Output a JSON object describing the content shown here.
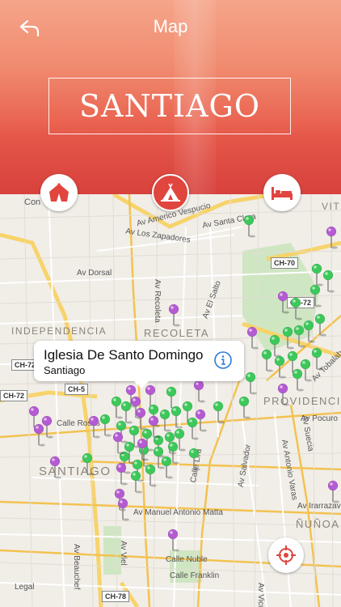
{
  "header": {
    "title": "Map",
    "city": "SANTIAGO"
  },
  "icons": {
    "back": "back-arrow-icon",
    "attractions": "circus-tent-icon",
    "activities": "camping-tent-icon",
    "lodging": "bed-icon",
    "info": "info-icon",
    "locate": "crosshair-icon"
  },
  "callout": {
    "title": "Iglesia De Santo Domingo",
    "subtitle": "Santiago"
  },
  "map_labels": {
    "streets": [
      "Av Americo Vespucio",
      "Av Santa Clara",
      "Av Los Zapadores",
      "Av Dorsal",
      "Av Recoleta",
      "Av El Salto",
      "Calle Rosas",
      "Av Manuel Antonio Matta",
      "Calle Nuble",
      "Calle Franklin",
      "Calle Lira",
      "Av Salvador",
      "Av Suecia",
      "Av Antonio Varas",
      "Av Pocuro",
      "Av Irarrazaval",
      "Av Tobalaba",
      "Av Beauchef",
      "Av Viel",
      "Av Vicuna",
      "Legal"
    ],
    "districts": [
      "INDEPENDENCIA",
      "RECOLETA",
      "PROVIDENCIA",
      "SANTIAGO",
      "ÑUÑOA",
      "VIT"
    ],
    "highways": [
      "CH-70",
      "CH-72",
      "CH-72",
      "CH-72",
      "CH-5",
      "CH-78"
    ],
    "other": [
      "Con"
    ]
  },
  "colors": {
    "accent": "#e0453e",
    "green_pin": "#3cc85a",
    "purple_pin": "#b45ad2"
  }
}
